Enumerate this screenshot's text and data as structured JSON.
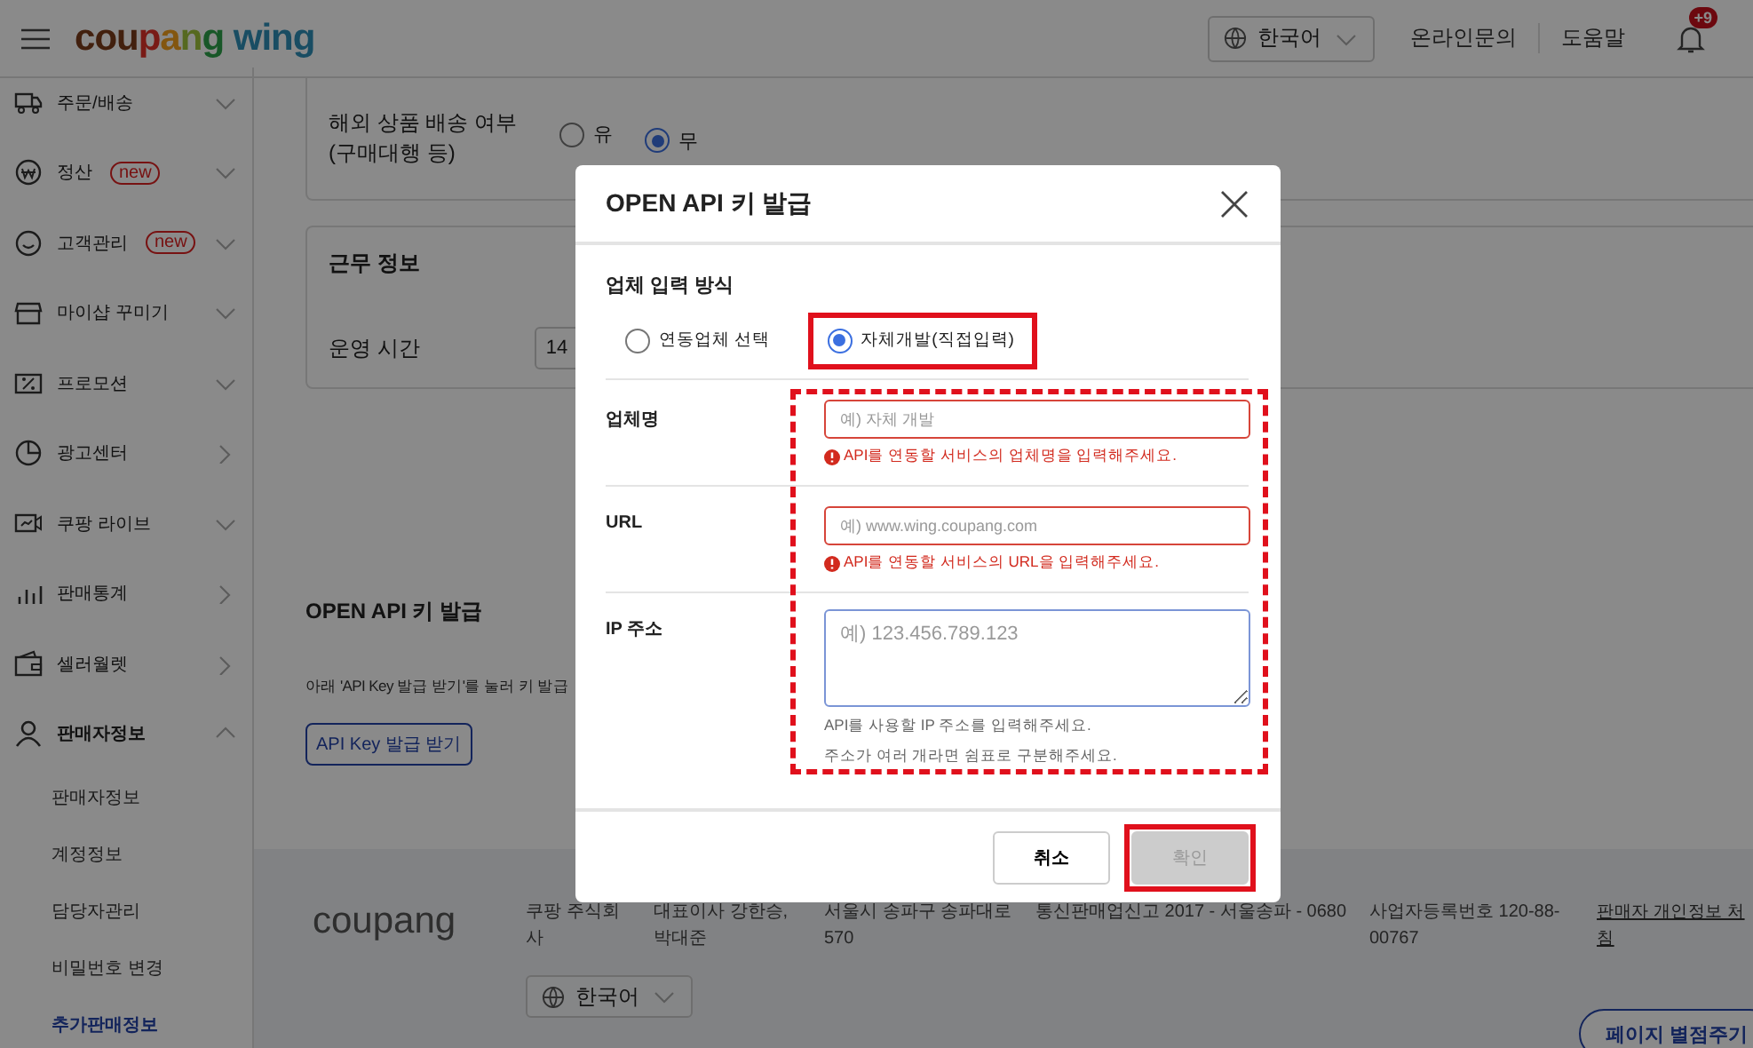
{
  "header": {
    "logo": "coupang wing",
    "language": "한국어",
    "links": [
      "온라인문의",
      "도움말"
    ],
    "notification_badge": "+9"
  },
  "sidebar": {
    "items": [
      {
        "label": "주문/배송",
        "expandable": true,
        "expanded": false
      },
      {
        "label": "정산",
        "badge": "new",
        "expandable": true,
        "expanded": false
      },
      {
        "label": "고객관리",
        "badge": "new",
        "expandable": true,
        "expanded": false
      },
      {
        "label": "마이샵 꾸미기",
        "expandable": true,
        "expanded": false
      },
      {
        "label": "프로모션",
        "expandable": true,
        "expanded": false
      },
      {
        "label": "광고센터",
        "expandable": false
      },
      {
        "label": "쿠팡 라이브",
        "expandable": true,
        "expanded": false
      },
      {
        "label": "판매통계",
        "expandable": false
      },
      {
        "label": "셀러월렛",
        "expandable": false
      },
      {
        "label": "판매자정보",
        "expandable": true,
        "expanded": true,
        "children": [
          {
            "label": "판매자정보",
            "selected": false
          },
          {
            "label": "계정정보",
            "selected": false
          },
          {
            "label": "담당자관리",
            "selected": false
          },
          {
            "label": "비밀번호 변경",
            "selected": false
          },
          {
            "label": "추가판매정보",
            "selected": true
          }
        ]
      }
    ]
  },
  "main": {
    "shipping_card": {
      "label_lines": [
        "해외 상품 배송 여부",
        "(구매대행 등)"
      ],
      "options": [
        {
          "label": "유",
          "selected": false
        },
        {
          "label": "무",
          "selected": true
        }
      ]
    },
    "work_card": {
      "title": "근무 정보",
      "label": "운영 시간",
      "value": "14"
    },
    "api_section": {
      "title": "OPEN API 키 발급",
      "description": "아래 'API Key 발급 받기'를 눌러 키 발급",
      "button": "API Key 발급 받기"
    }
  },
  "footer": {
    "logo": "coupang",
    "columns": [
      "쿠팡 주식회사",
      "대표이사 강한승,박대준",
      "서울시 송파구 송파대로 570",
      "통신판매업신고 2017 - 서울송파 - 0680",
      "사업자등록번호 120-88-00767"
    ],
    "privacy_link_lines": [
      "판매자 개인정보 처",
      "침"
    ],
    "language": "한국어",
    "rating_button": "페이지 별점주기"
  },
  "dialog": {
    "title": "OPEN API 키 발급",
    "section_title": "업체 입력 방식",
    "options": [
      {
        "label": "연동업체 선택",
        "selected": false,
        "highlighted": false
      },
      {
        "label": "자체개발(직접입력)",
        "selected": true,
        "highlighted": true
      }
    ],
    "fields_highlighted": true,
    "fields": [
      {
        "label": "업체명",
        "kind": "input",
        "placeholder": "예) 자체 개발",
        "error": "API를 연동할 서비스의 업체명을 입력해주세요."
      },
      {
        "label": "URL",
        "kind": "input",
        "placeholder": "예) www.wing.coupang.com",
        "error": "API를 연동할 서비스의 URL을 입력해주세요."
      },
      {
        "label": "IP 주소",
        "kind": "textarea",
        "placeholder": "예) 123.456.789.123",
        "help": [
          "API를 사용할 IP 주소를 입력해주세요.",
          "주소가 여러 개라면 쉼표로 구분해주세요."
        ]
      }
    ],
    "buttons": [
      {
        "label": "취소",
        "kind": "secondary",
        "disabled": false,
        "highlighted": false
      },
      {
        "label": "확인",
        "kind": "primary",
        "disabled": true,
        "highlighted": true
      }
    ]
  }
}
